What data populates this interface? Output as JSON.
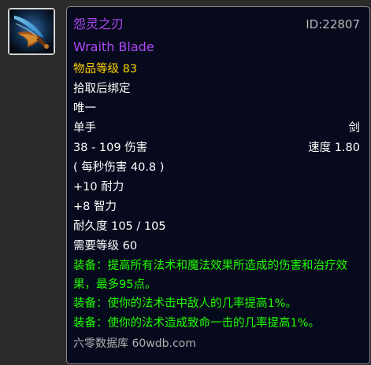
{
  "item": {
    "name_cn": "怨灵之刃",
    "id_label": "ID:22807",
    "name_en": "Wraith Blade",
    "item_level_label": "物品等级",
    "item_level_value": "83",
    "bind": "拾取后绑定",
    "unique": "唯一",
    "slot": "单手",
    "weapon_type": "剑",
    "damage": "38 - 109 伤害",
    "speed": "速度 1.80",
    "dps": "( 每秒伤害 40.8 )",
    "stat_stamina": "+10 耐力",
    "stat_intellect": "+8 智力",
    "durability": "耐久度 105 / 105",
    "required_level": "需要等级 60",
    "effects": [
      "装备：提高所有法术和魔法效果所造成的伤害和治疗效果，最多95点。",
      "装备：使你的法术击中敌人的几率提高1%。",
      "装备：使你的法术造成致命一击的几率提高1%。"
    ],
    "footer": "六零数据库 60wdb.com"
  },
  "colors": {
    "epic": "#b048f8",
    "item_level": "#ffd100",
    "equip_effect": "#1eff00"
  },
  "icon": "wraith-blade-sword-icon"
}
